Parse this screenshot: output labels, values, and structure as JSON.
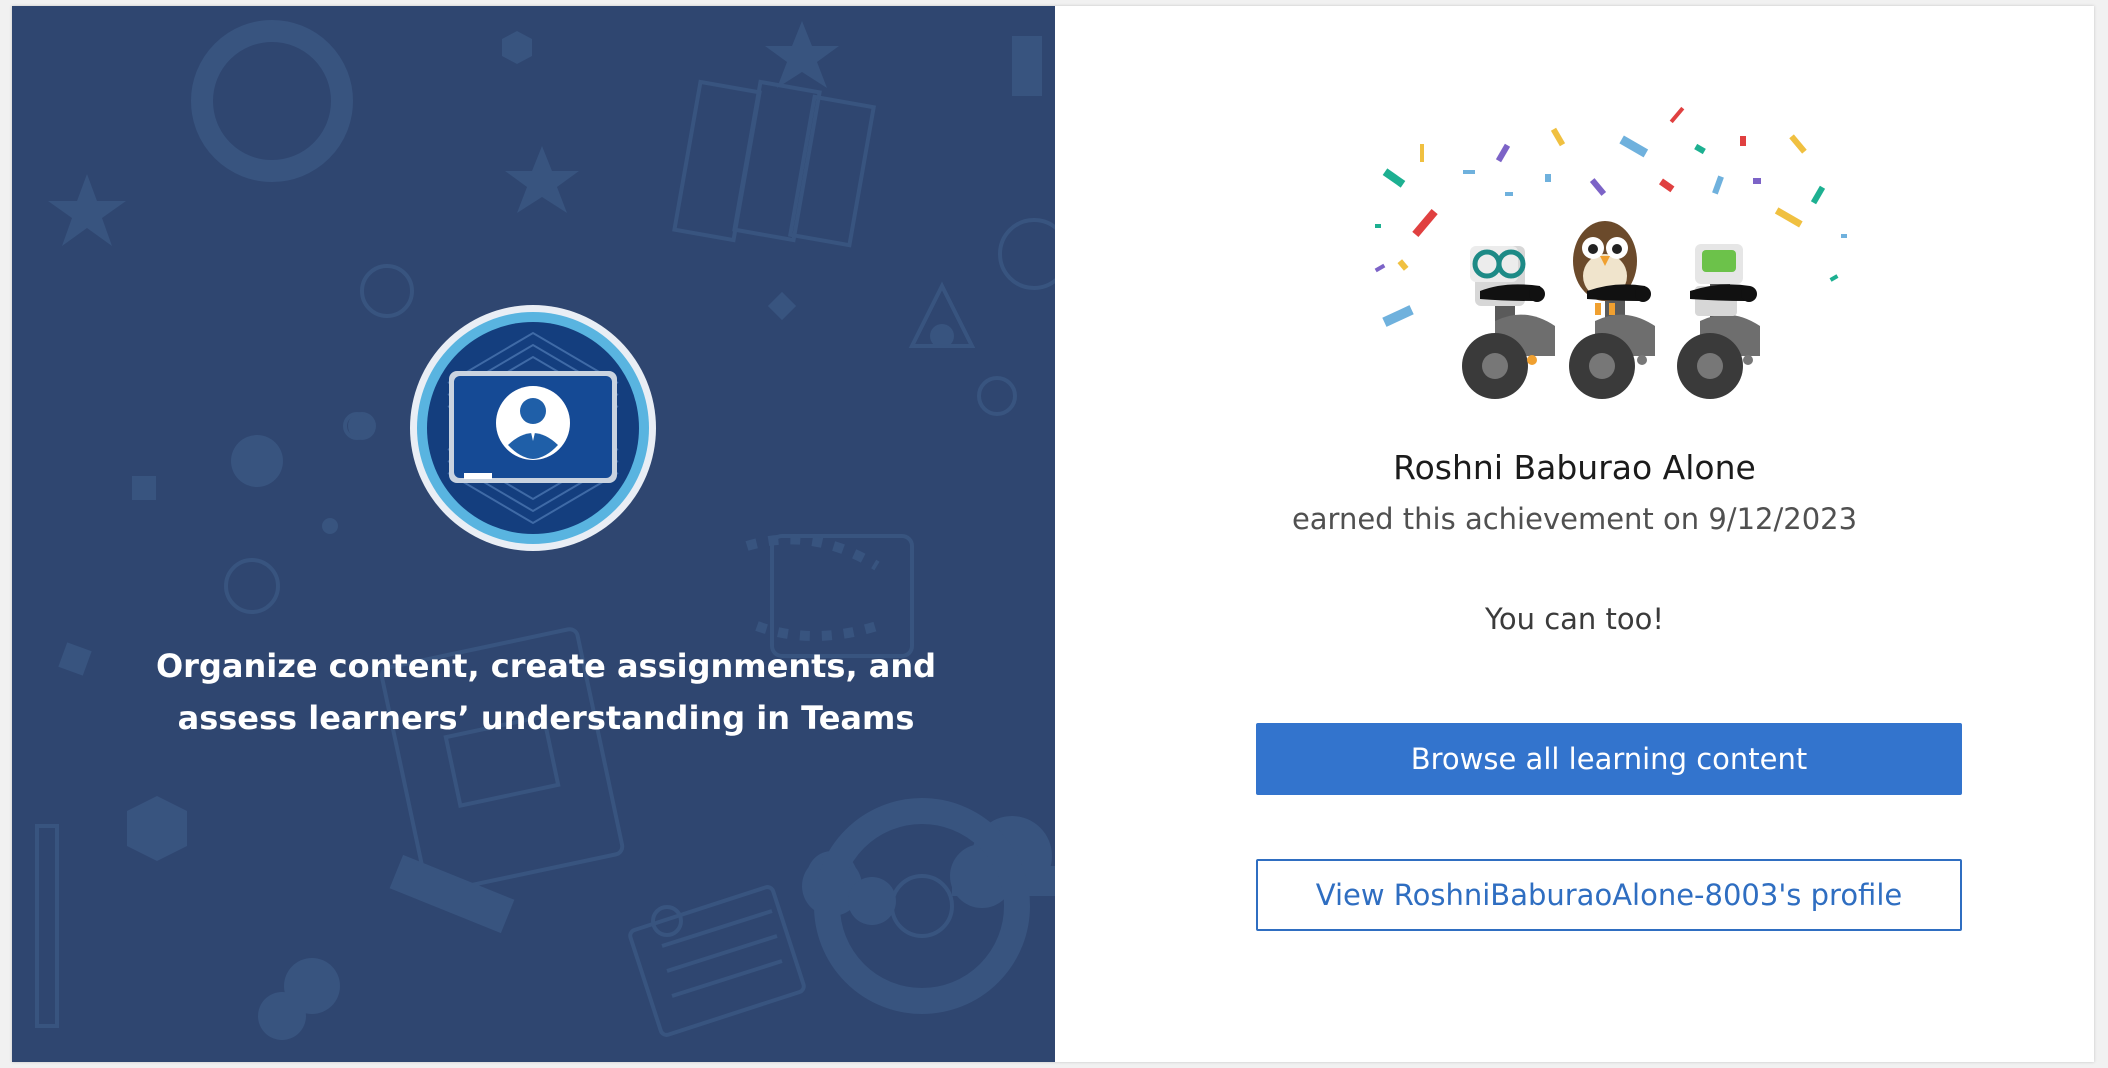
{
  "achievement": {
    "tagline": "Organize content, create assignments, and assess learners’ understanding in Teams",
    "badge_icon": "teacher-presentation-badge"
  },
  "earner": {
    "name": "Roshni Baburao Alone",
    "earned_text": "earned this achievement on 9/12/2023",
    "encouragement": "You can too!"
  },
  "actions": {
    "browse_label": "Browse all learning content",
    "profile_label": "View RoshniBaburaoAlone-8003's profile"
  },
  "colors": {
    "left_panel": "#2f4670",
    "primary_button": "#3374cd",
    "link_blue": "#2f6ec1"
  }
}
